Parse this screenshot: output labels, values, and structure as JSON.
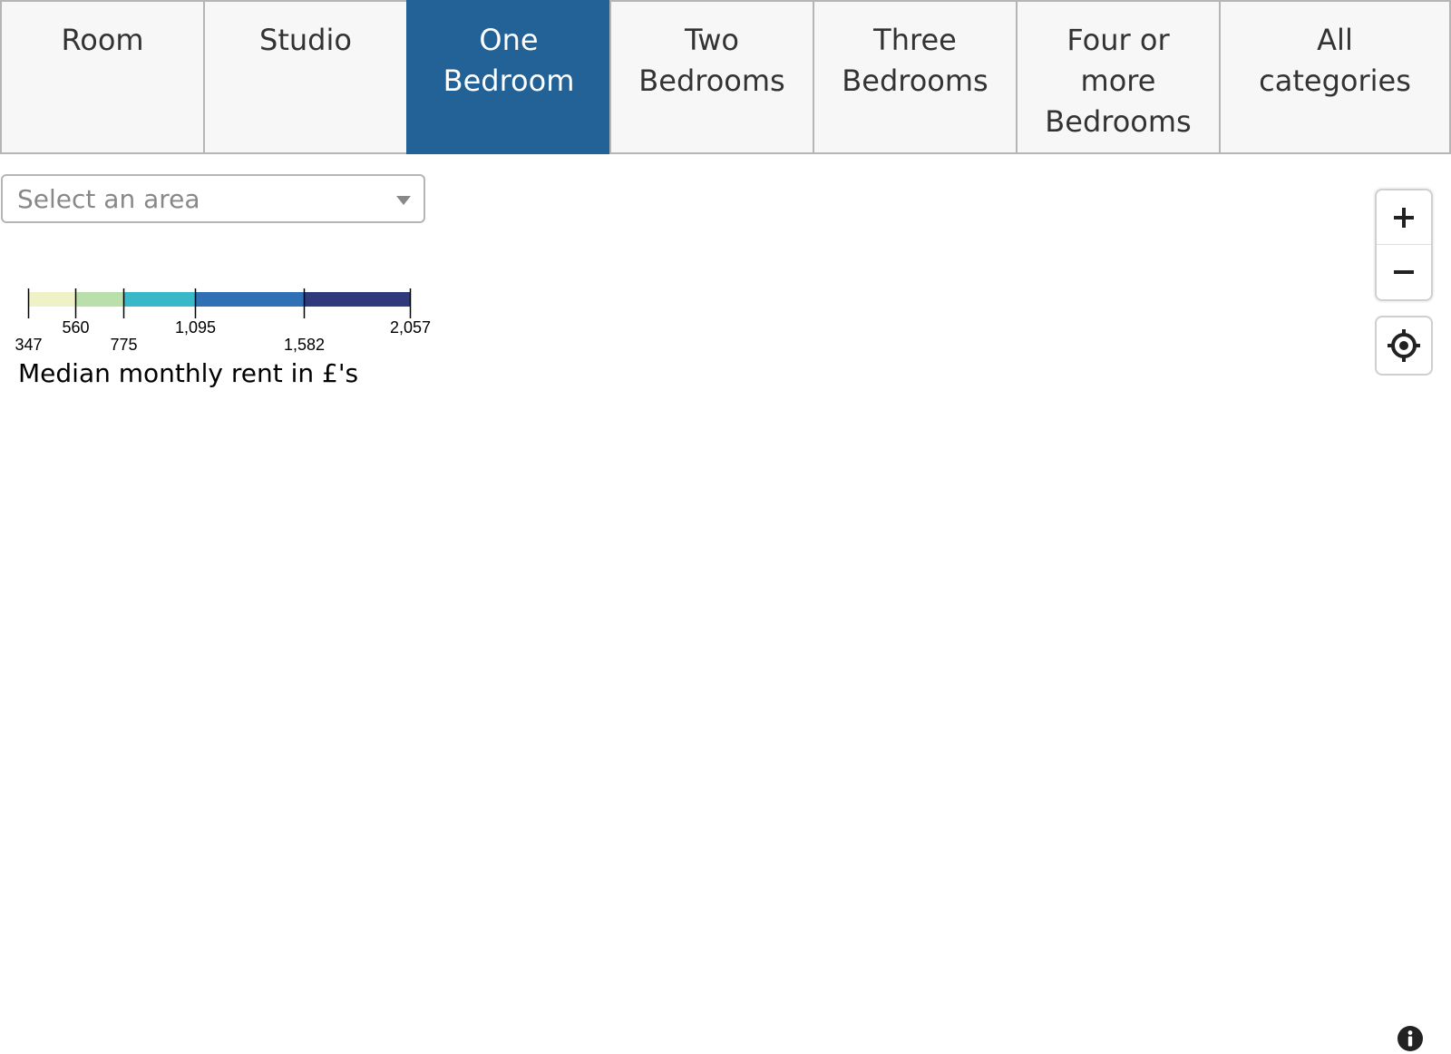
{
  "tabs": [
    {
      "label": "Room",
      "active": false
    },
    {
      "label": "Studio",
      "active": false
    },
    {
      "label": "One Bedroom",
      "active": true
    },
    {
      "label": "Two Bedrooms",
      "active": false
    },
    {
      "label": "Three Bedrooms",
      "active": false
    },
    {
      "label": "Four or more Bedrooms",
      "active": false
    },
    {
      "label": "All categories",
      "active": false
    }
  ],
  "tab_line_labels": [
    [
      "Room"
    ],
    [
      "Studio"
    ],
    [
      "One",
      "Bedroom"
    ],
    [
      "Two",
      "Bedrooms"
    ],
    [
      "Three",
      "Bedrooms"
    ],
    [
      "Four or",
      "more",
      "Bedrooms"
    ],
    [
      "All",
      "categories"
    ]
  ],
  "area_select": {
    "placeholder": "Select an area"
  },
  "legend": {
    "title": "Median monthly rent in £'s",
    "breaks": [
      347,
      560,
      775,
      1095,
      1582,
      2057
    ],
    "break_labels": [
      "347",
      "560",
      "775",
      "1,095",
      "1,582",
      "2,057"
    ],
    "colors": [
      "#eef2c6",
      "#b9e0aa",
      "#39b8c8",
      "#3070b4",
      "#2e3a7c"
    ]
  },
  "controls": {
    "zoom_in_icon": "plus-icon",
    "zoom_out_icon": "minus-icon",
    "locate_icon": "crosshair-icon",
    "info_icon": "info-icon"
  },
  "colors": {
    "active_tab": "#226296",
    "tab_bg": "#f7f7f7",
    "tab_border": "#b5b5b5"
  }
}
